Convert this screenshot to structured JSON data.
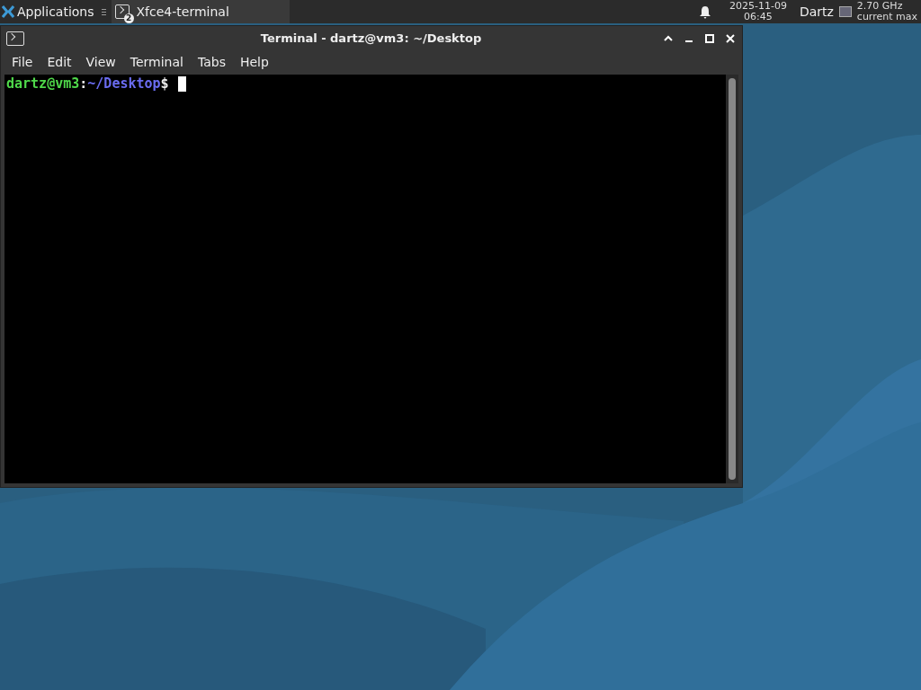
{
  "panel": {
    "applications": "Applications",
    "tasks": [
      {
        "title": "Xfce4-terminal",
        "badge": "2",
        "selected": true
      }
    ],
    "clock": {
      "date": "2025-11-09",
      "time": "06:45"
    },
    "user": "Dartz",
    "cpu": [
      "2.70 GHz",
      "current max"
    ]
  },
  "window": {
    "title": "Terminal - dartz@vm3: ~/Desktop",
    "menu": [
      "File",
      "Edit",
      "View",
      "Terminal",
      "Tabs",
      "Help"
    ],
    "prompt": {
      "user_host": "dartz@vm3",
      "separator": ":",
      "path": "~/Desktop",
      "symbol": "$"
    }
  }
}
